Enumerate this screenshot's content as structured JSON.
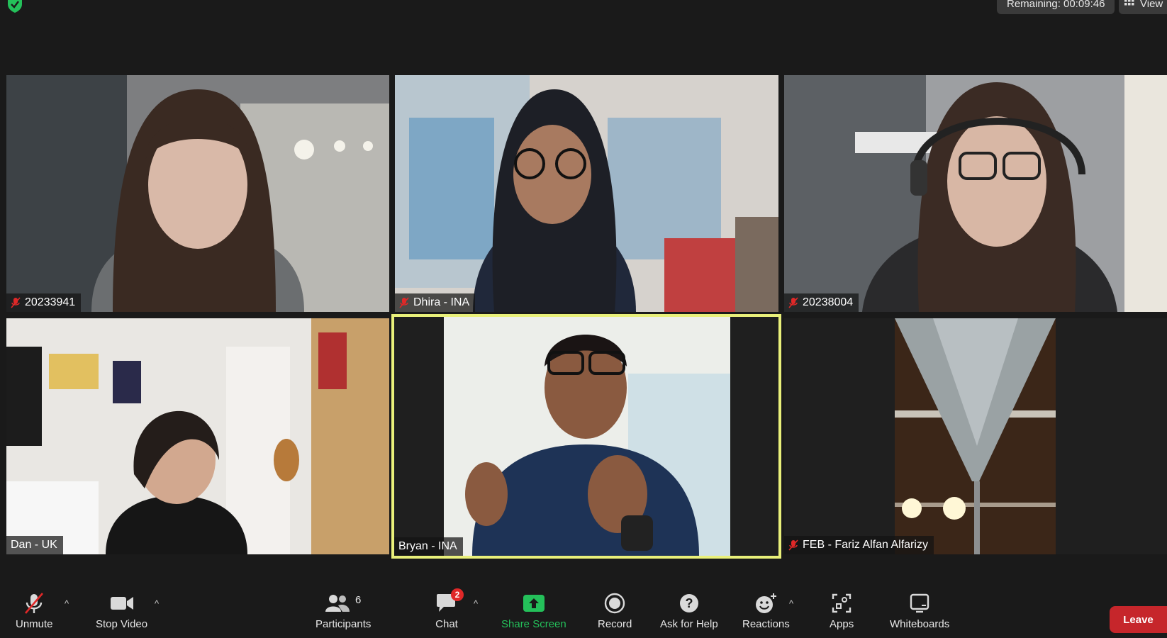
{
  "meeting": {
    "remaining_label": "Remaining: 00:09:46",
    "view_label": "View"
  },
  "participants": [
    {
      "name": "20233941",
      "muted": true
    },
    {
      "name": "Dhira - INA",
      "muted": true
    },
    {
      "name": "20238004",
      "muted": true
    },
    {
      "name": "Dan - UK",
      "muted": false
    },
    {
      "name": "Bryan - INA",
      "muted": false,
      "active_speaker": true
    },
    {
      "name": "FEB - Fariz Alfan Alfarizy",
      "muted": true
    }
  ],
  "toolbar": {
    "unmute_label": "Unmute",
    "stop_video_label": "Stop Video",
    "participants_label": "Participants",
    "participants_count": "6",
    "chat_label": "Chat",
    "chat_badge": "2",
    "share_screen_label": "Share Screen",
    "record_label": "Record",
    "ask_for_help_label": "Ask for Help",
    "reactions_label": "Reactions",
    "apps_label": "Apps",
    "whiteboards_label": "Whiteboards",
    "leave_label": "Leave"
  },
  "colors": {
    "active_speaker_border": "#e9f07a",
    "share_screen_green": "#24c05a",
    "leave_red": "#c6262b",
    "mute_red": "#e02828"
  },
  "icons": [
    "shield-check-icon",
    "grid-icon",
    "mic-muted-icon",
    "video-camera-icon",
    "participants-icon",
    "chat-icon",
    "share-screen-icon",
    "record-icon",
    "help-icon",
    "reactions-icon",
    "apps-icon",
    "whiteboard-icon",
    "caret-up-icon"
  ]
}
